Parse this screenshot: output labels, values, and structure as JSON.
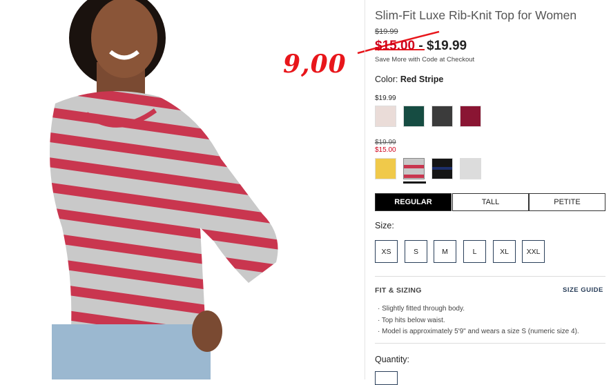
{
  "product": {
    "title": "Slim-Fit Luxe Rib-Knit Top for Women",
    "original_price": "$19.99",
    "sale_price": "$15.00",
    "price_separator": " - ",
    "regular_price": "$19.99",
    "save_note": "Save More with Code at Checkout"
  },
  "annotation": {
    "handwritten_price": "9,00",
    "color": "#e8161b"
  },
  "color": {
    "label": "Color:",
    "selected": "Red Stripe",
    "group1_price": "$19.99",
    "group2_orig_price": "$19.99",
    "group2_sale_price": "$15.00",
    "swatches_group1": [
      {
        "name": "light-pink",
        "color": "#eadcd8"
      },
      {
        "name": "dark-green",
        "color": "#164c42"
      },
      {
        "name": "charcoal",
        "color": "#3b3b3b"
      },
      {
        "name": "burgundy",
        "color": "#8a1533"
      }
    ],
    "swatches_group2": [
      {
        "name": "yellow",
        "color": "#f0c94a"
      },
      {
        "name": "red-stripe",
        "color": "#c8c8c8"
      },
      {
        "name": "navy-stripe",
        "color": "#151515"
      },
      {
        "name": "light-gray",
        "color": "#dcdcdc"
      }
    ]
  },
  "fit_tabs": [
    "REGULAR",
    "TALL",
    "PETITE"
  ],
  "size": {
    "label": "Size:",
    "options": [
      "XS",
      "S",
      "M",
      "L",
      "XL",
      "XXL"
    ]
  },
  "fit_sizing": {
    "heading": "FIT & SIZING",
    "guide_link": "SIZE GUIDE",
    "bullets": [
      "· Slightly fitted through body.",
      "· Top hits below waist.",
      "· Model is approximately 5'9\" and wears a size S (numeric size 4)."
    ]
  },
  "quantity": {
    "label": "Quantity:"
  }
}
